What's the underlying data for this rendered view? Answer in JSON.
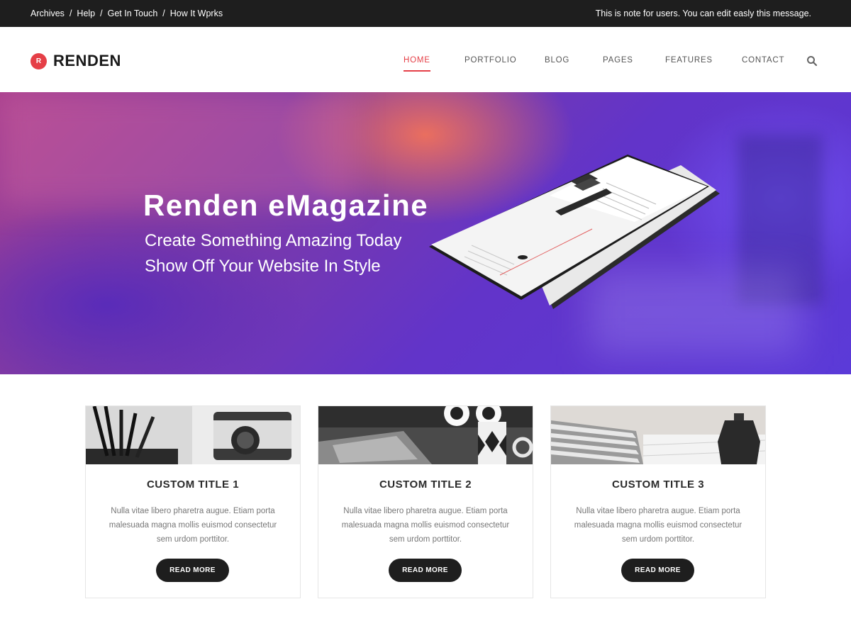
{
  "topbar": {
    "links": [
      "Archives",
      "Help",
      "Get In Touch",
      "How It Wprks"
    ],
    "separator": "/",
    "note": "This is note for users. You can edit easly this message."
  },
  "header": {
    "logo_mark": "R",
    "logo_text": "RENDEN",
    "nav": [
      "HOME",
      "PORTFOLIO",
      "BLOG",
      "PAGES",
      "FEATURES",
      "CONTACT"
    ],
    "active_nav": "HOME",
    "search_icon": "search-icon"
  },
  "hero": {
    "title": "Renden eMagazine",
    "subtitle_1": "Create Something Amazing Today",
    "subtitle_2": "Show Off Your Website In Style"
  },
  "cards": [
    {
      "title": "CUSTOM TITLE 1",
      "description": "Nulla vitae libero pharetra augue. Etiam porta malesuada magna mollis euismod consectetur sem urdom porttitor.",
      "button": "READ MORE"
    },
    {
      "title": "CUSTOM TITLE 2",
      "description": "Nulla vitae libero pharetra augue. Etiam porta malesuada magna mollis euismod consectetur sem urdom porttitor.",
      "button": "READ MORE"
    },
    {
      "title": "CUSTOM TITLE 3",
      "description": "Nulla vitae libero pharetra augue. Etiam porta malesuada magna mollis euismod consectetur sem urdom porttitor.",
      "button": "READ MORE"
    }
  ],
  "colors": {
    "accent": "#e53f47",
    "topbar_bg": "#1e1e1e",
    "button_bg": "#1e1e1e"
  }
}
